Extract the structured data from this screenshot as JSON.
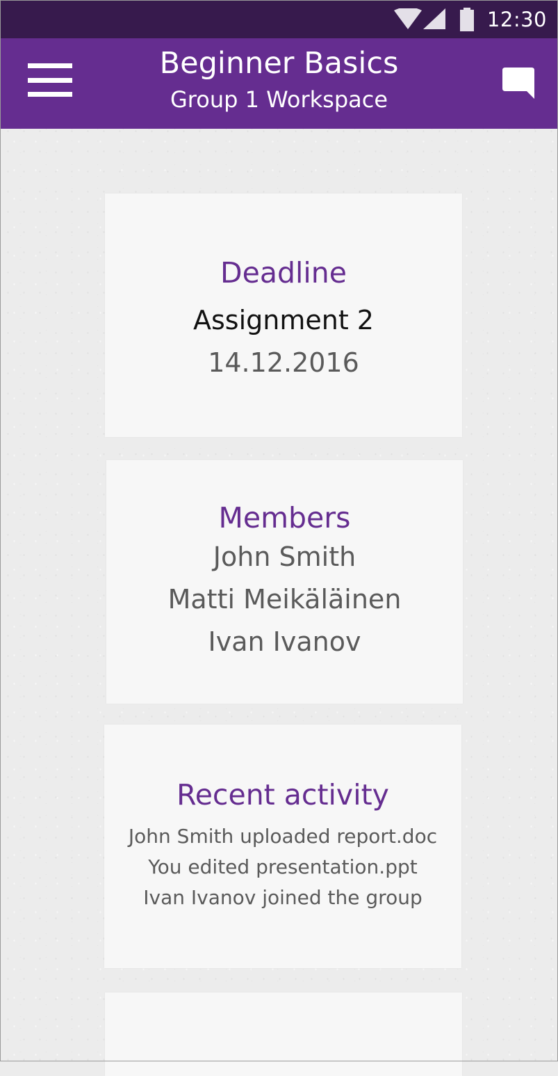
{
  "status_bar": {
    "time": "12:30",
    "icons": [
      "wifi-icon",
      "signal-icon",
      "battery-icon"
    ],
    "background_color": "#371a4d"
  },
  "app_bar": {
    "title": "Beginner Basics",
    "subtitle": "Group 1 Workspace",
    "left_icon": "hamburger-menu-icon",
    "right_icon": "chat-bubble-icon",
    "background_color": "#652d90"
  },
  "cards": {
    "deadline": {
      "heading": "Deadline",
      "assignment": "Assignment 2",
      "date": "14.12.2016"
    },
    "members": {
      "heading": "Members",
      "names": [
        "John Smith",
        "Matti Meikäläinen",
        "Ivan Ivanov"
      ]
    },
    "activity": {
      "heading": "Recent activity",
      "items": [
        "John Smith uploaded report.doc",
        "You edited presentation.ppt",
        "Ivan Ivanov joined the group"
      ]
    }
  },
  "colors": {
    "accent": "#652d90",
    "card_background": "#f7f7f7",
    "page_background": "#ececec"
  }
}
